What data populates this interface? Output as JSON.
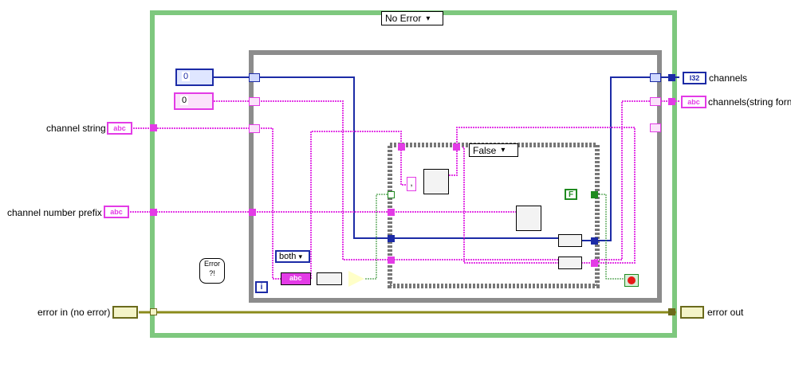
{
  "outer_case": {
    "selector": "No Error",
    "arrow": "▾"
  },
  "inner_case": {
    "selector": "False",
    "arrow": "▾"
  },
  "controls": {
    "channel_string": "channel string",
    "channel_number_prefix": "channel number prefix",
    "error_in": "error in (no error)"
  },
  "indicators": {
    "channels": "channels",
    "channels_string": "channels(string forn",
    "error_out": "error out"
  },
  "constants": {
    "numeric_zero_a": "0",
    "numeric_zero_b": "0",
    "both_enum": "both",
    "false_const": "F",
    "comma_const": ","
  },
  "terminals": {
    "i32_label": "I32",
    "abc_label": "abc",
    "iteration": "i"
  },
  "colors": {
    "string_wire": "#e33be6",
    "numeric_wire": "#1c2ba6",
    "error_wire": "#8b8b1c",
    "case_border": "#7ec87e",
    "loop_border": "#8c8c8c"
  }
}
